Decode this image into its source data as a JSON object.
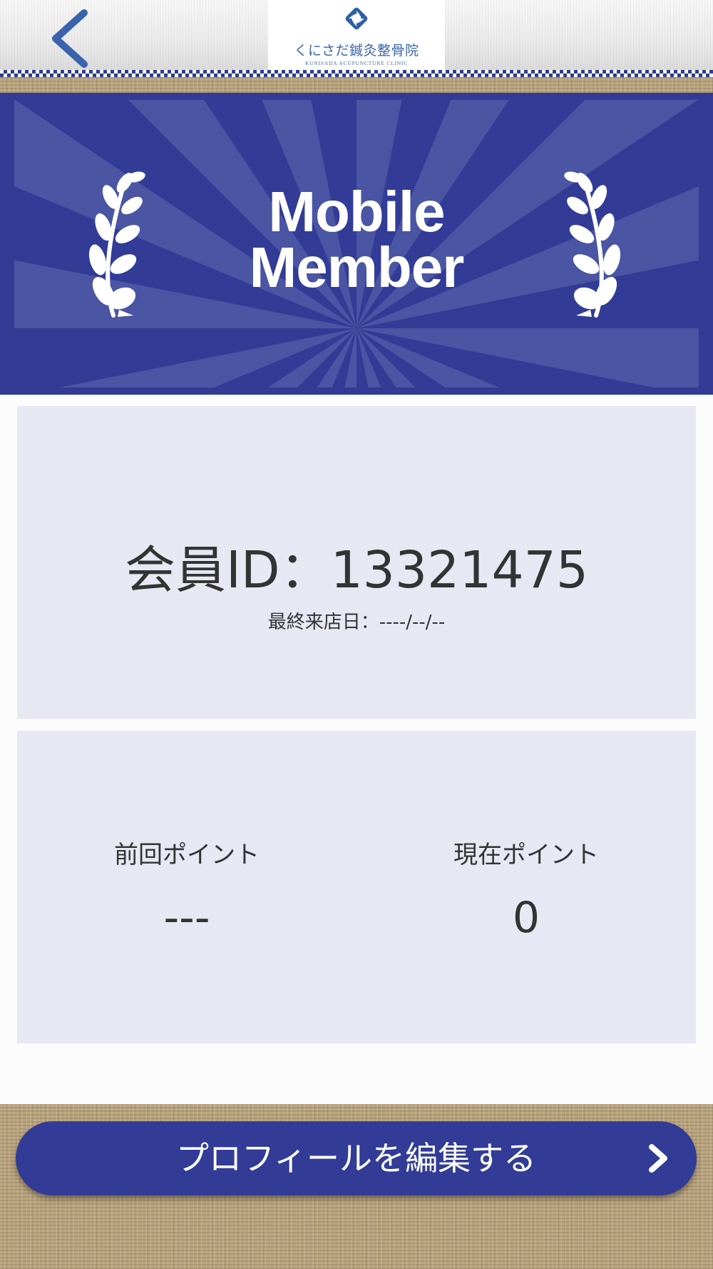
{
  "header": {
    "back_icon": "chevron-left-icon",
    "logo_icon": "clinic-logo-mark-icon",
    "logo_title": "くにさだ鍼灸整骨院",
    "logo_subtitle": "KUNISADA ACUPUNCTURE CLINIC"
  },
  "banner": {
    "title_line1": "Mobile",
    "title_line2": "Member",
    "decoration_icon": "laurel-branch-icon"
  },
  "member_card": {
    "member_id_label": "会員ID：",
    "member_id": "13321475",
    "last_visit_label": "最終来店日：",
    "last_visit_value": "----/--/--"
  },
  "points_card": {
    "previous_label": "前回ポイント",
    "previous_value": "---",
    "current_label": "現在ポイント",
    "current_value": "0"
  },
  "footer": {
    "edit_profile_label": "プロフィールを編集する",
    "edit_profile_icon": "chevron-right-icon"
  },
  "colors": {
    "brand_navy": "#323c97",
    "ray_light": "#4a55a3",
    "card_bg": "#e8e8f4",
    "text": "#333333",
    "logo_blue": "#3c66a8",
    "burlap": "#b9a47f"
  }
}
